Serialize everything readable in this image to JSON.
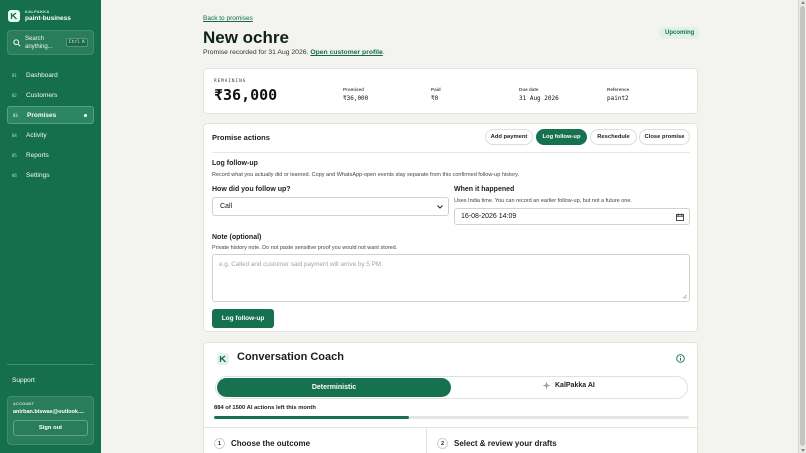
{
  "brand": {
    "small": "KALPAKKA",
    "name": "paint-business"
  },
  "search": {
    "label": "Search anything...",
    "shortcut": "Ctrl K"
  },
  "nav": [
    {
      "num": "01",
      "label": "Dashboard",
      "active": false
    },
    {
      "num": "02",
      "label": "Customers",
      "active": false
    },
    {
      "num": "03",
      "label": "Promises",
      "active": true
    },
    {
      "num": "04",
      "label": "Activity",
      "active": false
    },
    {
      "num": "05",
      "label": "Reports",
      "active": false
    },
    {
      "num": "06",
      "label": "Settings",
      "active": false
    }
  ],
  "support": "Support",
  "account": {
    "label": "ACCOUNT",
    "email": "anirban.biswas@outlook....",
    "signout": "Sign out"
  },
  "header": {
    "back": "Back to promises",
    "title": "New ochre",
    "subtitle_prefix": "Promise recorded for 31 Aug 2026.",
    "profile_link": "Open customer profile",
    "subtitle_suffix": ".",
    "status": "Upcoming"
  },
  "summary": {
    "remaining_label": "REMAINING",
    "remaining_value": "₹36,000",
    "promised_label": "Promised",
    "promised_value": "₹36,000",
    "paid_label": "Paid",
    "paid_value": "₹0",
    "due_label": "Due date",
    "due_value": "31 Aug 2026",
    "ref_label": "Reference",
    "ref_value": "paint2"
  },
  "actions": {
    "title": "Promise actions",
    "buttons": [
      "Add payment",
      "Log follow-up",
      "Reschedule",
      "Close promise"
    ],
    "form_title": "Log follow-up",
    "form_desc": "Record what you actually did or learned. Copy and WhatsApp-open events stay separate from this confirmed follow-up history.",
    "how_label": "How did you follow up?",
    "how_value": "Call",
    "when_label": "When it happened",
    "when_hint": "Uses India time. You can record an earlier follow-up, but not a future one.",
    "when_value": "16-08-2026 14:09",
    "note_label": "Note (optional)",
    "note_hint": "Private history note. Do not paste sensitive proof you would not want stored.",
    "note_placeholder": "e.g. Called and customer said payment will arrive by 5 PM.",
    "submit": "Log follow-up"
  },
  "coach": {
    "title": "Conversation Coach",
    "mode_active": "Deterministic",
    "mode_ai": "KalPakka AI",
    "usage_text": "884 of 1500 AI actions left this month",
    "usage_fraction": 0.41,
    "step1_num": "1",
    "step1": "Choose the outcome",
    "step2_num": "2",
    "step2": "Select & review your drafts"
  },
  "colors": {
    "brand": "#156e4c",
    "accent": "#167150",
    "badge_bg": "#dff1ea"
  }
}
